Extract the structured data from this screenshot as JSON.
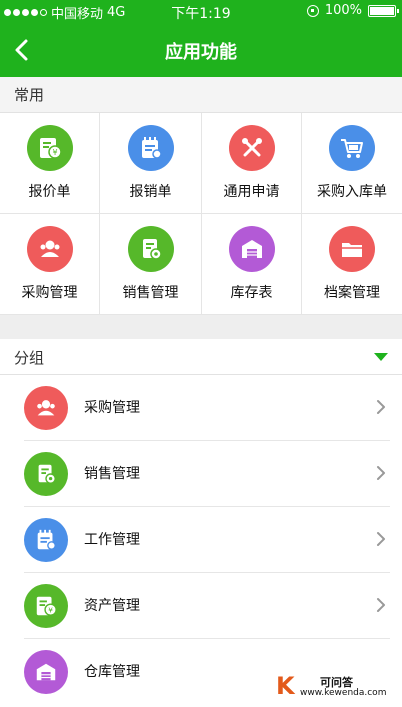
{
  "status": {
    "carrier": "中国移动",
    "network": "4G",
    "time": "下午1:19",
    "battery": "100%"
  },
  "nav": {
    "title": "应用功能"
  },
  "common": {
    "label": "常用",
    "items": [
      {
        "label": "报价单",
        "icon": "invoice-yen-icon",
        "color": "#56b82a"
      },
      {
        "label": "报销单",
        "icon": "calendar-note-icon",
        "color": "#4a8fe8"
      },
      {
        "label": "通用申请",
        "icon": "tools-icon",
        "color": "#ef5b5b"
      },
      {
        "label": "采购入库单",
        "icon": "cart-icon",
        "color": "#4a8fe8"
      },
      {
        "label": "采购管理",
        "icon": "users-icon",
        "color": "#ef5b5b"
      },
      {
        "label": "销售管理",
        "icon": "sales-doc-icon",
        "color": "#56b82a"
      },
      {
        "label": "库存表",
        "icon": "warehouse-icon",
        "color": "#b35ad6"
      },
      {
        "label": "档案管理",
        "icon": "folder-icon",
        "color": "#ef5b5b"
      }
    ]
  },
  "group": {
    "label": "分组",
    "items": [
      {
        "label": "采购管理",
        "icon": "users-icon",
        "color": "#ef5b5b"
      },
      {
        "label": "销售管理",
        "icon": "sales-doc-icon",
        "color": "#56b82a"
      },
      {
        "label": "工作管理",
        "icon": "calendar-note-icon",
        "color": "#4a8fe8"
      },
      {
        "label": "资产管理",
        "icon": "invoice-yen-icon",
        "color": "#56b82a"
      },
      {
        "label": "仓库管理",
        "icon": "warehouse-icon",
        "color": "#b35ad6"
      }
    ]
  },
  "watermark": {
    "logo": "K",
    "title": "可问答",
    "url": "www.kewenda.com"
  }
}
